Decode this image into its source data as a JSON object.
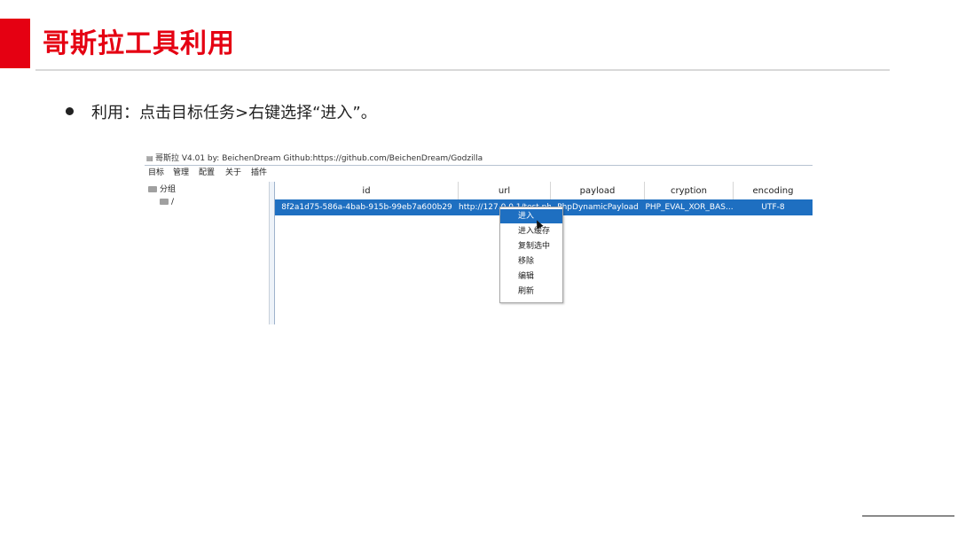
{
  "slide": {
    "title": "哥斯拉工具利用",
    "bullet": "利用：点击目标任务>右键选择“进入”。",
    "accent_color": "#e50012"
  },
  "app": {
    "window_title": "哥斯拉 V4.01 by: BeichenDream Github:https://github.com/BeichenDream/Godzilla",
    "menu": [
      "目标",
      "管理",
      "配置",
      "关于",
      "插件"
    ],
    "tree": {
      "root": "分组",
      "child": "/"
    },
    "table": {
      "columns": [
        "id",
        "url",
        "payload",
        "cryption",
        "encoding"
      ],
      "row": {
        "id": "8f2a1d75-586a-4bab-915b-99eb7a600b29",
        "url": "http://127.0.0.1/test.php",
        "payload": "PhpDynamicPayload",
        "cryption": "PHP_EVAL_XOR_BAS...",
        "encoding": "UTF-8"
      }
    },
    "context_menu": [
      "进入",
      "进入缓存",
      "复制选中",
      "移除",
      "编辑",
      "刷新"
    ],
    "selection_color": "#1e6fc1"
  }
}
